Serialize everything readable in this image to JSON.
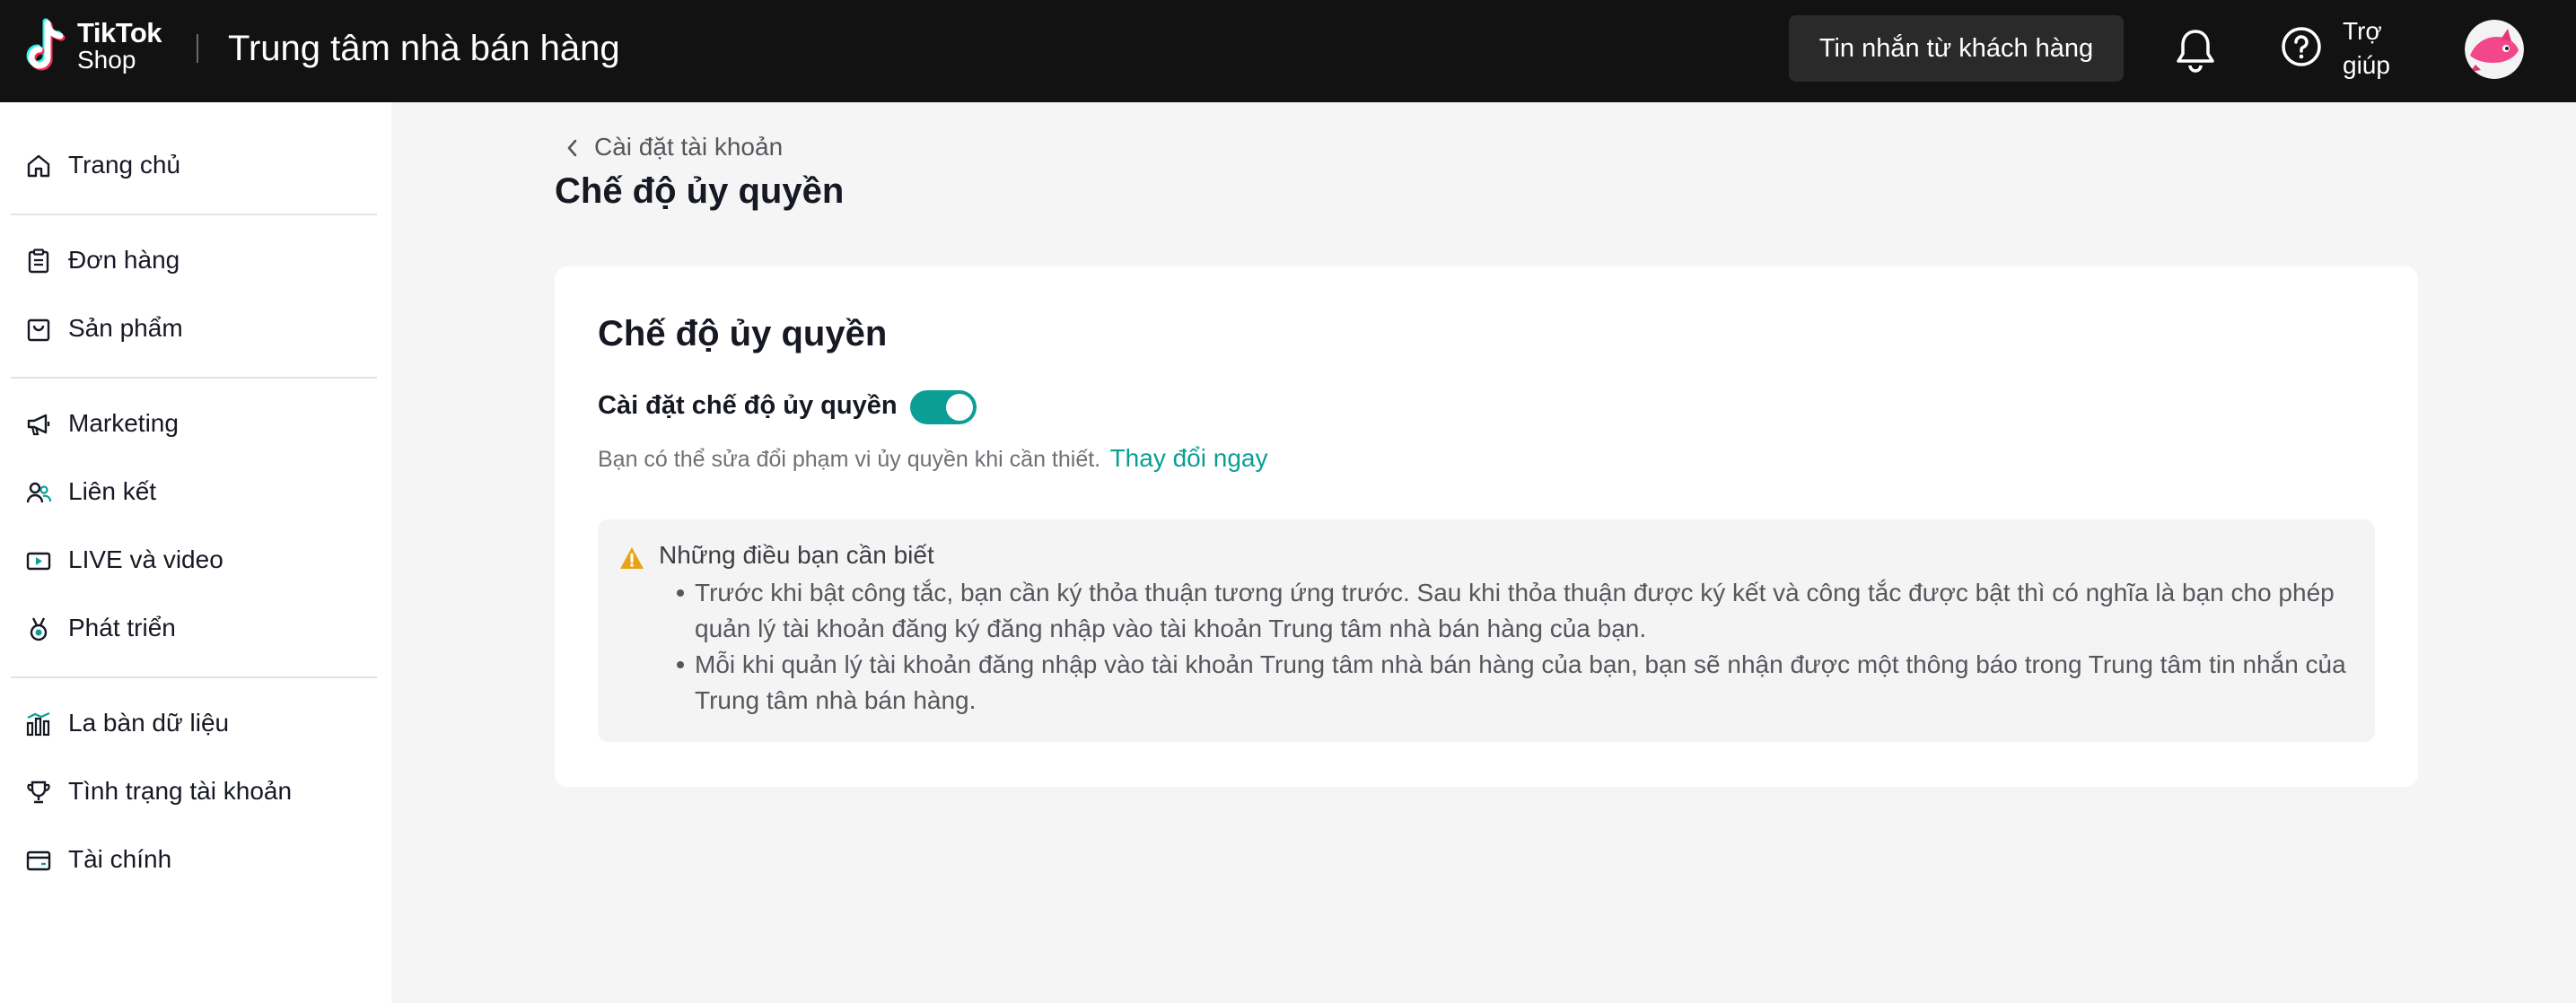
{
  "header": {
    "logo_line1": "TikTok",
    "logo_line2": "Shop",
    "title": "Trung tâm nhà bán hàng",
    "messages_button": "Tin nhắn từ khách hàng",
    "help_label": "Trợ giúp",
    "icons": {
      "bell": "bell-icon",
      "help": "help-circle-icon"
    }
  },
  "sidebar": {
    "items": [
      {
        "label": "Trang chủ",
        "icon": "home-icon"
      },
      {
        "label": "Đơn hàng",
        "icon": "clipboard-icon"
      },
      {
        "label": "Sản phẩm",
        "icon": "bag-icon"
      },
      {
        "label": "Marketing",
        "icon": "megaphone-icon"
      },
      {
        "label": "Liên kết",
        "icon": "users-icon"
      },
      {
        "label": "LIVE và video",
        "icon": "video-icon"
      },
      {
        "label": "Phát triển",
        "icon": "medal-icon"
      },
      {
        "label": "La bàn dữ liệu",
        "icon": "bar-chart-icon"
      },
      {
        "label": "Tình trạng tài khoản",
        "icon": "trophy-icon"
      },
      {
        "label": "Tài chính",
        "icon": "wallet-icon"
      }
    ]
  },
  "main": {
    "breadcrumb": "Cài đặt tài khoản",
    "page_title": "Chế độ ủy quyền",
    "card": {
      "title": "Chế độ ủy quyền",
      "setting_label": "Cài đặt chế độ ủy quyền",
      "toggle_on": true,
      "hint_text": "Bạn có thể sửa đổi phạm vi ủy quyền khi cần thiết.",
      "hint_link": "Thay đổi ngay",
      "notice": {
        "title": "Những điều bạn cần biết",
        "items": [
          "Trước khi bật công tắc, bạn cần ký thỏa thuận tương ứng trước. Sau khi thỏa thuận được ký kết và công tắc được bật thì có nghĩa là bạn cho phép quản lý tài khoản đăng ký đăng nhập vào tài khoản Trung tâm nhà bán hàng của bạn.",
          "Mỗi khi quản lý tài khoản đăng nhập vào tài khoản Trung tâm nhà bán hàng của bạn, bạn sẽ nhận được một thông báo trong Trung tâm tin nhắn của Trung tâm nhà bán hàng."
        ]
      }
    }
  },
  "colors": {
    "topbar": "#121212",
    "accent": "#0b9e95",
    "warning": "#f0a020",
    "background": "#f5f5f5"
  }
}
